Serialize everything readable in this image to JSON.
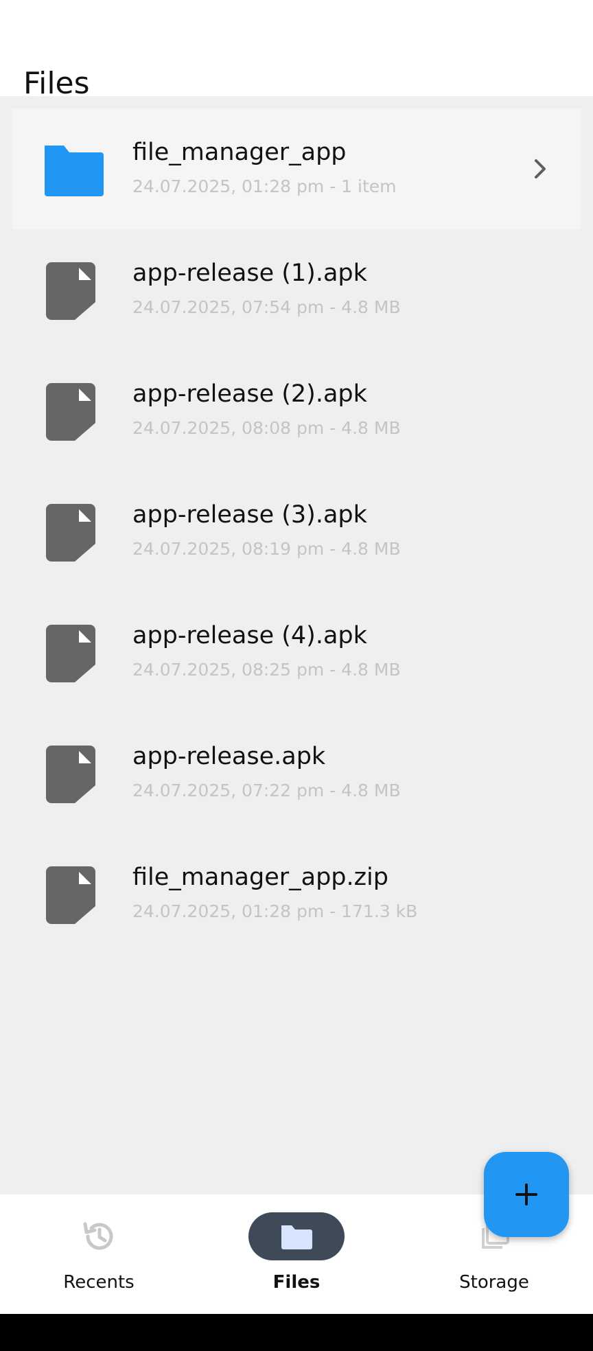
{
  "header": {
    "title": "Files"
  },
  "files": [
    {
      "name": "file_manager_app",
      "meta": "24.07.2025, 01:28 pm - 1 item",
      "type": "folder",
      "icon": "folder-icon",
      "selected": true
    },
    {
      "name": "app-release (1).apk",
      "meta": "24.07.2025, 07:54 pm - 4.8 MB",
      "type": "file",
      "icon": "file-icon"
    },
    {
      "name": "app-release (2).apk",
      "meta": "24.07.2025, 08:08 pm - 4.8 MB",
      "type": "file",
      "icon": "file-icon"
    },
    {
      "name": "app-release (3).apk",
      "meta": "24.07.2025, 08:19 pm - 4.8 MB",
      "type": "file",
      "icon": "file-icon"
    },
    {
      "name": "app-release (4).apk",
      "meta": "24.07.2025, 08:25 pm - 4.8 MB",
      "type": "file",
      "icon": "file-icon"
    },
    {
      "name": "app-release.apk",
      "meta": "24.07.2025, 07:22 pm - 4.8 MB",
      "type": "file",
      "icon": "file-icon"
    },
    {
      "name": "file_manager_app.zip",
      "meta": "24.07.2025, 01:28 pm - 171.3 kB",
      "type": "file",
      "icon": "file-icon"
    }
  ],
  "fab": {
    "icon": "plus-icon"
  },
  "bottom_nav": {
    "items": [
      {
        "label": "Recents",
        "icon": "history-icon",
        "active": false
      },
      {
        "label": "Files",
        "icon": "folder-icon",
        "active": true
      },
      {
        "label": "Storage",
        "icon": "storage-icon",
        "active": false
      }
    ]
  },
  "colors": {
    "accent": "#2196f3",
    "file_icon": "#666666",
    "meta_text": "#c4c4c4",
    "content_bg": "#efefef",
    "active_pill": "#3f4a59"
  }
}
